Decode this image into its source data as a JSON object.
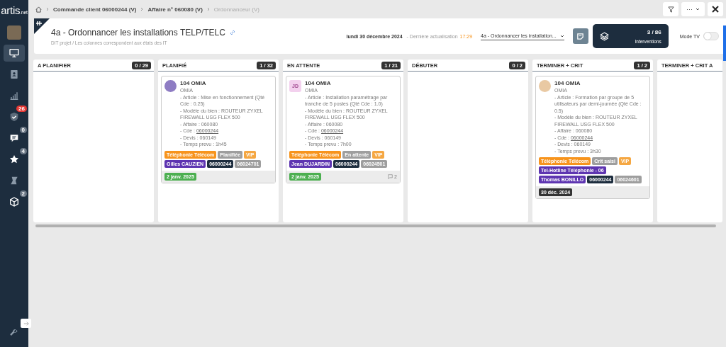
{
  "sidebar": {
    "logo": "artis",
    "logo_suffix": ".net",
    "items": [
      {
        "selected": true
      },
      {
        "selected": false
      },
      {
        "selected": false
      },
      {
        "selected": false,
        "badge": {
          "text": "26",
          "color": "#e53935"
        }
      },
      {
        "selected": false,
        "badge": {
          "text": "0",
          "color": "#6b7785"
        }
      },
      {
        "selected": false,
        "badge": {
          "text": "4",
          "color": "#6b7785"
        }
      },
      {
        "selected": false
      },
      {
        "selected": false,
        "badge": {
          "text": "2",
          "color": "#6b7785"
        }
      }
    ]
  },
  "breadcrumb": [
    "Commande client 06000244 (V)",
    "Affaire n° 060080 (V)",
    "Ordonnanceur (V)"
  ],
  "toolbar": {
    "more": "···"
  },
  "header": {
    "title": "4a - Ordonnancer les installations TELP/TELC",
    "subtitle": "DIT projet / Les colonnes correspondent aux états des IT",
    "date": "lundi 30 décembre 2024",
    "refresh_label": "- Dernière actualisation",
    "refresh_time": "17:29",
    "view_select": "4a - Ordonnancer les installation...",
    "counter": "3 / 86",
    "counter_label": "Interventions",
    "tv_mode": {
      "label": "Mode TV",
      "on": false
    }
  },
  "columns": [
    {
      "title": "A PLANIFIER",
      "count": "0 / 29"
    },
    {
      "title": "PLANIFIÉ",
      "count": "1 / 32",
      "cards": [
        {
          "avatar": {
            "kind": "picture",
            "color": "#8e7cc3"
          },
          "title": "104 OMIA",
          "client": "OMIA",
          "lines": [
            {
              "text": "- Article : Mise en fonctionnement (Qté Cde : 0.25)"
            },
            {
              "text": "- Modèle du bien : ROUTEUR ZYXEL FIREWALL USG FLEX 500"
            },
            {
              "text": "- Affaire : 060080"
            },
            {
              "text": "- Cde : ",
              "link": "06000244"
            },
            {
              "text": "- Devis : 060149"
            },
            {
              "text": "- Temps prevu : 1h45"
            }
          ],
          "tags": [
            {
              "label": "Téléphonie Télécom",
              "color": "#f7941d"
            },
            {
              "label": "Planifiée",
              "color": "#9e9e9e"
            },
            {
              "label": "VIP",
              "color": "#f5a742"
            },
            {
              "label": "Gilles CAUZIEN",
              "color": "#5e35b1"
            },
            {
              "label": "06000244",
              "color": "#1d2d3e"
            },
            {
              "label": "06024701",
              "color": "#9e9e9e"
            }
          ],
          "date": {
            "label": "2 janv. 2025",
            "color": "#4caf50"
          }
        }
      ]
    },
    {
      "title": "EN ATTENTE",
      "count": "1 / 21",
      "cards": [
        {
          "avatar": {
            "kind": "initials",
            "text": "JD",
            "color": "#f3d1ee"
          },
          "title": "104 OMIA",
          "client": "OMIA",
          "lines": [
            {
              "text": "- Article : Installation paramétrage par tranche de 5 postes (Qté Cde : 1.0)"
            },
            {
              "text": "- Modèle du bien : ROUTEUR ZYXEL FIREWALL USG FLEX 500"
            },
            {
              "text": "- Affaire : 060080"
            },
            {
              "text": "- Cde : ",
              "link": "06000244"
            },
            {
              "text": "- Devis : 060149"
            },
            {
              "text": "- Temps prevu : 7h00"
            }
          ],
          "tags": [
            {
              "label": "Téléphonie Télécom",
              "color": "#f7941d"
            },
            {
              "label": "En attente",
              "color": "#9e9e9e"
            },
            {
              "label": "VIP",
              "color": "#f5a742"
            },
            {
              "label": "Jean DUJARDIN",
              "color": "#5e35b1"
            },
            {
              "label": "06000244",
              "color": "#1d2d3e"
            },
            {
              "label": "06024501",
              "color": "#9e9e9e"
            }
          ],
          "date": {
            "label": "2 janv. 2025",
            "color": "#4caf50"
          },
          "comments": "2"
        }
      ]
    },
    {
      "title": "DÉBUTER",
      "count": "0 / 2"
    },
    {
      "title": "TERMINER + CRIT",
      "count": "1 / 2",
      "cards": [
        {
          "avatar": {
            "kind": "picture",
            "color": "#e9c9a3"
          },
          "title": "104 OMIA",
          "client": "OMIA",
          "lines": [
            {
              "text": "- Article : Formation par groupe de 5 utilisateurs par demi-journée (Qté Cde : 0.5)"
            },
            {
              "text": "- Modèle du bien : ROUTEUR ZYXEL FIREWALL USG FLEX 500"
            },
            {
              "text": "- Affaire : 060080"
            },
            {
              "text": "- Cde : ",
              "link": "06000244"
            },
            {
              "text": "- Devis : 060149"
            },
            {
              "text": "- Temps prevu : 3h30"
            }
          ],
          "tags": [
            {
              "label": "Téléphonie Télécom",
              "color": "#f7941d"
            },
            {
              "label": "Crit saisi",
              "color": "#9e9e9e"
            },
            {
              "label": "VIP",
              "color": "#f5a742"
            },
            {
              "label": "Tel-Hotline Téléphonie - 06",
              "color": "#5e35b1"
            },
            {
              "label": "Thomas BONILLO",
              "color": "#5e35b1"
            },
            {
              "label": "06000244",
              "color": "#1d2d3e"
            },
            {
              "label": "06024601",
              "color": "#9e9e9e"
            }
          ],
          "date": {
            "label": "30 déc. 2024",
            "color": "#333333"
          }
        }
      ]
    },
    {
      "title": "TERMINER + CRIT A"
    }
  ]
}
